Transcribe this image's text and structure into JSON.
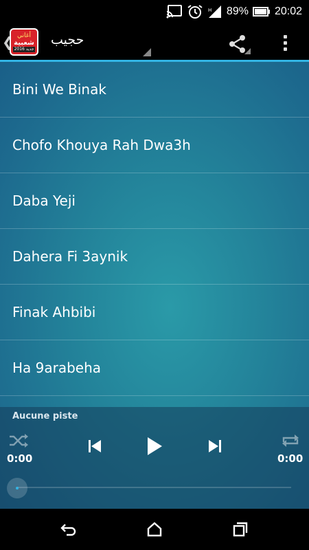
{
  "status_bar": {
    "battery_percent": "89%",
    "time": "20:02"
  },
  "action_bar": {
    "app_logo": {
      "line1": "أغاني",
      "line2": "شعبية",
      "line3": "جديد 2016"
    },
    "title": "حجيب",
    "share_icon": "share-icon",
    "overflow_icon": "overflow-menu-icon"
  },
  "tracks": [
    "Bini We Binak",
    "Chofo Khouya Rah Dwa3h",
    "Daba Yeji",
    "Dahera Fi 3aynik",
    "Finak Ahbibi",
    "Ha 9arabeha"
  ],
  "player": {
    "now_playing": "Aucune piste",
    "time_elapsed": "0:00",
    "time_total": "0:00",
    "progress": 0,
    "icons": [
      "shuffle-icon",
      "previous-icon",
      "play-icon",
      "next-icon",
      "repeat-icon"
    ]
  },
  "nav_bar": {
    "icons": [
      "back-icon",
      "home-icon",
      "recents-icon"
    ]
  },
  "colors": {
    "accent": "#33b5e5",
    "content_bg": "#23839a"
  }
}
